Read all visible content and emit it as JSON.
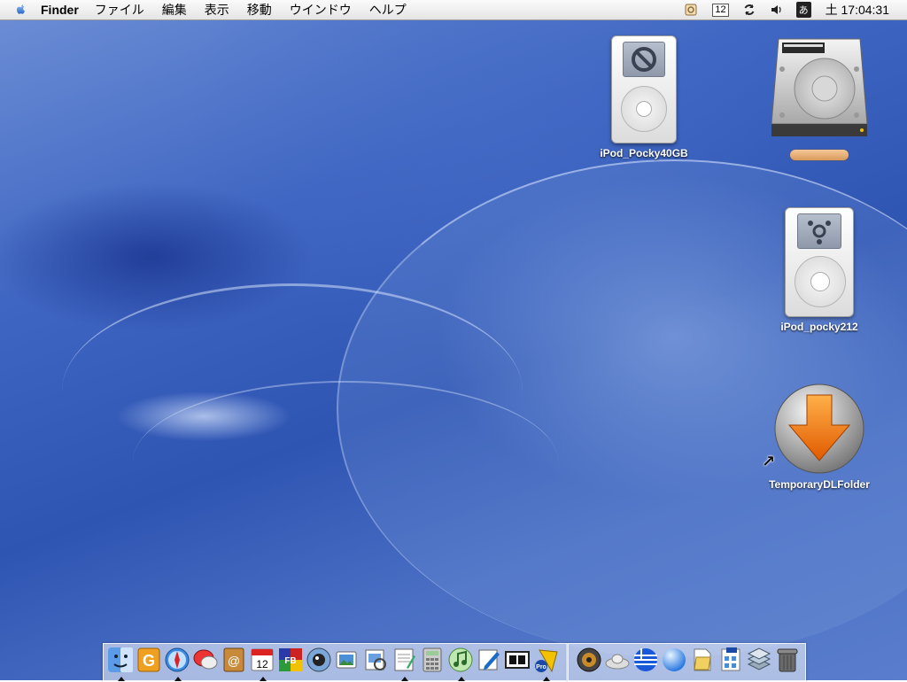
{
  "menubar": {
    "app_name": "Finder",
    "menus": [
      "ファイル",
      "編集",
      "表示",
      "移動",
      "ウインドウ",
      "ヘルプ"
    ],
    "extras": {
      "calendar_day": "12",
      "input_method": "あ",
      "clock": "土 17:04:31"
    }
  },
  "desktop": {
    "icons": [
      {
        "label": "iPod_Pocky40GB",
        "type": "ipod-disabled"
      },
      {
        "label": "",
        "type": "hard-drive"
      },
      {
        "label": "iPod_pocky212",
        "type": "ipod-firewire"
      },
      {
        "label": "TemporaryDLFolder",
        "type": "download-folder-alias"
      }
    ]
  },
  "dock": {
    "left_items": [
      {
        "name": "finder-icon",
        "running": true
      },
      {
        "name": "grab-g-icon",
        "running": false
      },
      {
        "name": "safari-compass-icon",
        "running": true
      },
      {
        "name": "ichat-icon",
        "running": false
      },
      {
        "name": "address-book-icon",
        "running": false
      },
      {
        "name": "ical-icon",
        "running": true
      },
      {
        "name": "fb-app-icon",
        "running": false
      },
      {
        "name": "itunes-camera-icon",
        "running": false
      },
      {
        "name": "iphoto-icon",
        "running": false
      },
      {
        "name": "preview-icon",
        "running": false
      },
      {
        "name": "textedit-icon",
        "running": true
      },
      {
        "name": "calculator-icon",
        "running": false
      },
      {
        "name": "itunes-icon",
        "running": true
      },
      {
        "name": "writing-pen-icon",
        "running": false
      },
      {
        "name": "dictionary-icon",
        "running": false
      },
      {
        "name": "pro-app-icon",
        "running": true
      }
    ],
    "right_items": [
      {
        "name": "speaker-icon"
      },
      {
        "name": "cloud-disk-icon"
      },
      {
        "name": "greek-flag-icon"
      },
      {
        "name": "glass-sphere-icon"
      },
      {
        "name": "document-folder-icon"
      },
      {
        "name": "site-document-icon"
      },
      {
        "name": "stacked-books-icon"
      },
      {
        "name": "trash-icon"
      }
    ]
  }
}
